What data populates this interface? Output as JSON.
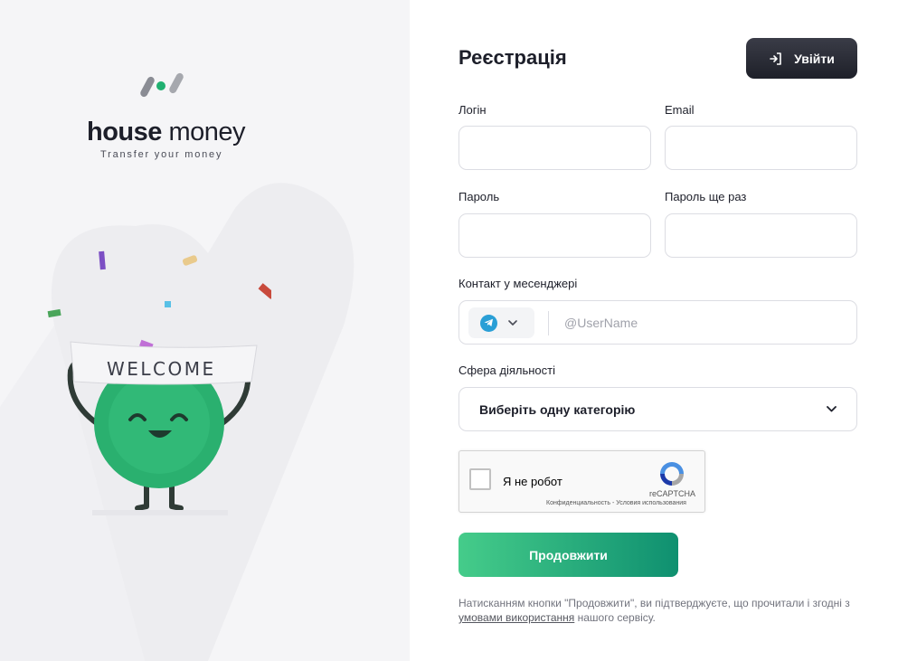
{
  "brand": {
    "name_bold": "house",
    "name_light": "money",
    "tagline": "Transfer your money",
    "welcome_text": "WELCOME"
  },
  "form": {
    "title": "Реєстрація",
    "login_button": "Увійти",
    "login_label": "Логін",
    "email_label": "Email",
    "password_label": "Пароль",
    "password_repeat_label": "Пароль ще раз",
    "messenger_label": "Контакт у месенджері",
    "messenger_selected": "telegram",
    "messenger_placeholder": "@UserName",
    "activity_label": "Сфера діяльності",
    "activity_selected": "Виберіть одну категорію",
    "captcha_label": "Я не робот",
    "captcha_brand": "reCAPTCHA",
    "captcha_links": "Конфиденциальность - Условия использования",
    "continue_button": "Продовжити",
    "terms_prefix": "Натисканням кнопки \"Продовжити\", ви підтверджуєте, що прочитали і згодні з ",
    "terms_link": "умовами використання",
    "terms_suffix": " нашого сервісу."
  },
  "colors": {
    "accent_green": "#1fa872",
    "dark_button": "#23252f",
    "telegram_blue": "#2a9fd6"
  },
  "icons": {
    "login": "login-icon",
    "messenger": "telegram-icon",
    "dropdown": "chevron-down-icon",
    "captcha": "recaptcha-icon"
  }
}
